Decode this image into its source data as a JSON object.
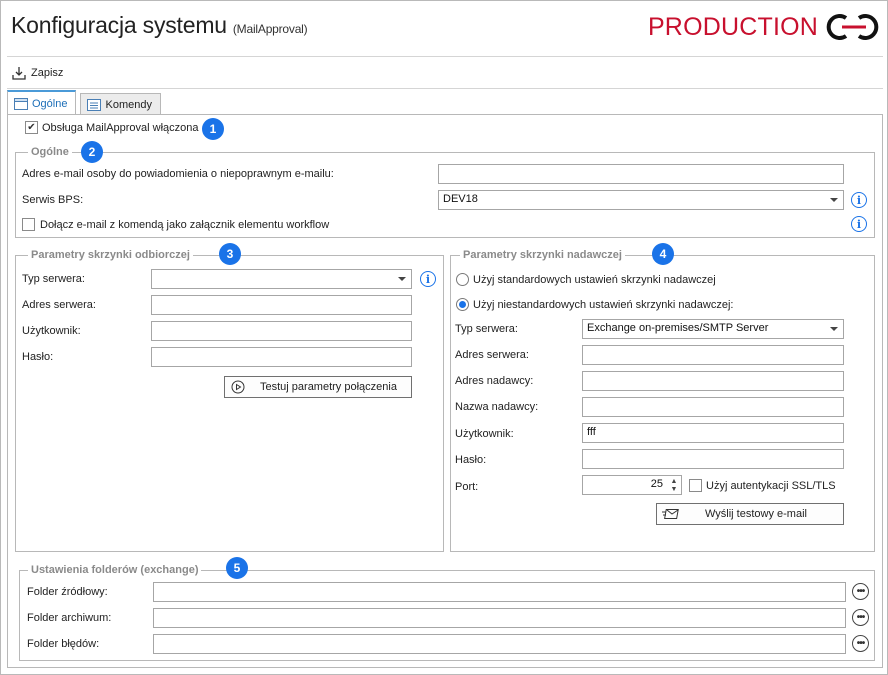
{
  "window": {
    "title": "Konfiguracja systemu",
    "subtitle": "(MailApproval)",
    "brand": "PRODUCTION"
  },
  "toolbar": {
    "save_label": "Zapisz"
  },
  "tabs": [
    {
      "label": "Ogólne",
      "active": true
    },
    {
      "label": "Komendy",
      "active": false
    }
  ],
  "main": {
    "enabled_checkbox": {
      "label": "Obsługa MailApproval włączona",
      "checked": true,
      "badge": "1"
    }
  },
  "general": {
    "legend": "Ogólne",
    "badge": "2",
    "invalid_email_label": "Adres e-mail osoby do powiadomienia o niepoprawnym e-mailu:",
    "invalid_email_value": "",
    "bps_label": "Serwis BPS:",
    "bps_value": "DEV18",
    "attach_label": "Dołącz e-mail z komendą jako załącznik elementu workflow",
    "attach_checked": false
  },
  "inbox": {
    "legend": "Parametry skrzynki odbiorczej",
    "badge": "3",
    "server_type_label": "Typ serwera:",
    "server_type_value": "",
    "server_address_label": "Adres serwera:",
    "server_address_value": "",
    "user_label": "Użytkownik:",
    "user_value": "",
    "password_label": "Hasło:",
    "password_value": "",
    "test_button": "Testuj parametry połączenia"
  },
  "outbox": {
    "legend": "Parametry skrzynki nadawczej",
    "badge": "4",
    "radio_standard": "Użyj standardowych ustawień skrzynki nadawczej",
    "radio_custom": "Użyj niestandardowych ustawień skrzynki nadawczej:",
    "selected": "custom",
    "server_type_label": "Typ serwera:",
    "server_type_value": "Exchange on-premises/SMTP Server",
    "server_address_label": "Adres serwera:",
    "server_address_value": "",
    "sender_address_label": "Adres nadawcy:",
    "sender_address_value": "",
    "sender_name_label": "Nazwa nadawcy:",
    "sender_name_value": "",
    "user_label": "Użytkownik:",
    "user_value": "fff",
    "password_label": "Hasło:",
    "password_value": "",
    "port_label": "Port:",
    "port_value": "25",
    "ssl_label": "Użyj autentykacji SSL/TLS",
    "ssl_checked": false,
    "send_test_button": "Wyślij testowy e-mail"
  },
  "folders": {
    "legend": "Ustawienia folderów (exchange)",
    "badge": "5",
    "source_label": "Folder źródłowy:",
    "source_value": "",
    "archive_label": "Folder archiwum:",
    "archive_value": "",
    "error_label": "Folder błędów:",
    "error_value": ""
  },
  "colors": {
    "brand_red": "#c8102e",
    "badge_blue": "#1a73e8",
    "tab_accent": "#4a9ad8"
  },
  "icons": [
    "save-icon",
    "tab-general-icon",
    "tab-commands-icon",
    "info-icon",
    "play-icon",
    "mail-send-icon",
    "ellipsis-icon",
    "logo-icon"
  ]
}
